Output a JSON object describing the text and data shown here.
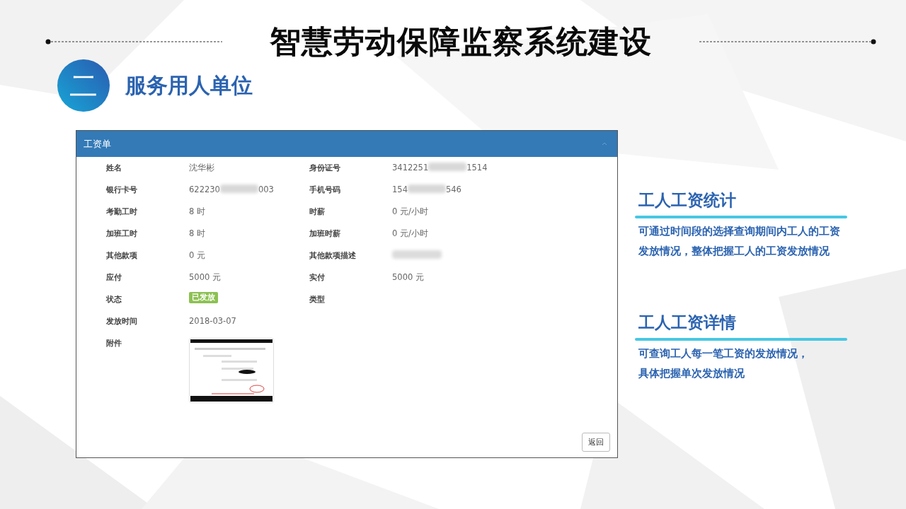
{
  "header": {
    "title": "智慧劳动保障监察系统建设"
  },
  "section": {
    "number": "二",
    "title": "服务用人单位"
  },
  "panel": {
    "title": "工资单",
    "rows": [
      {
        "fields": [
          {
            "label": "姓名",
            "kind": "text",
            "value": "沈华彬"
          },
          {
            "label": "身份证号",
            "kind": "redacted",
            "value": "3412251",
            "value_end": "1514"
          }
        ]
      },
      {
        "fields": [
          {
            "label": "银行卡号",
            "kind": "redacted",
            "value": "622230",
            "value_end": "003"
          },
          {
            "label": "手机号码",
            "kind": "redacted",
            "value": "154",
            "value_end": "546"
          }
        ]
      },
      {
        "fields": [
          {
            "label": "考勤工时",
            "kind": "text",
            "value": "8 时"
          },
          {
            "label": "时薪",
            "kind": "text",
            "value": "0 元/小时"
          }
        ]
      },
      {
        "fields": [
          {
            "label": "加班工时",
            "kind": "text",
            "value": "8 时"
          },
          {
            "label": "加班时薪",
            "kind": "text",
            "value": "0 元/小时"
          }
        ]
      },
      {
        "fields": [
          {
            "label": "其他款项",
            "kind": "text",
            "value": "0 元"
          },
          {
            "label": "其他款项描述",
            "kind": "blurred"
          }
        ]
      },
      {
        "fields": [
          {
            "label": "应付",
            "kind": "text",
            "value": "5000 元"
          },
          {
            "label": "实付",
            "kind": "text",
            "value": "5000 元"
          }
        ]
      },
      {
        "fields": [
          {
            "label": "状态",
            "kind": "badge",
            "value": "已发放",
            "color": "#8cc152"
          },
          {
            "label": "类型",
            "kind": "empty"
          }
        ]
      },
      {
        "fields": [
          {
            "label": "发放时间",
            "kind": "text",
            "value": "2018-03-07"
          }
        ]
      },
      {
        "fields": [
          {
            "label": "附件",
            "kind": "picture"
          }
        ]
      }
    ],
    "back_button": "返回"
  },
  "features": [
    {
      "title": "工人工资统计",
      "description_lines": [
        "可通过时间段的选择查询期间内工人的工资",
        "发放情况，整体把握工人的工资发放情况"
      ]
    },
    {
      "title": "工人工资详情",
      "description_lines": [
        "可查询工人每一笔工资的发放情况，",
        "具体把握单次发放情况"
      ]
    }
  ]
}
